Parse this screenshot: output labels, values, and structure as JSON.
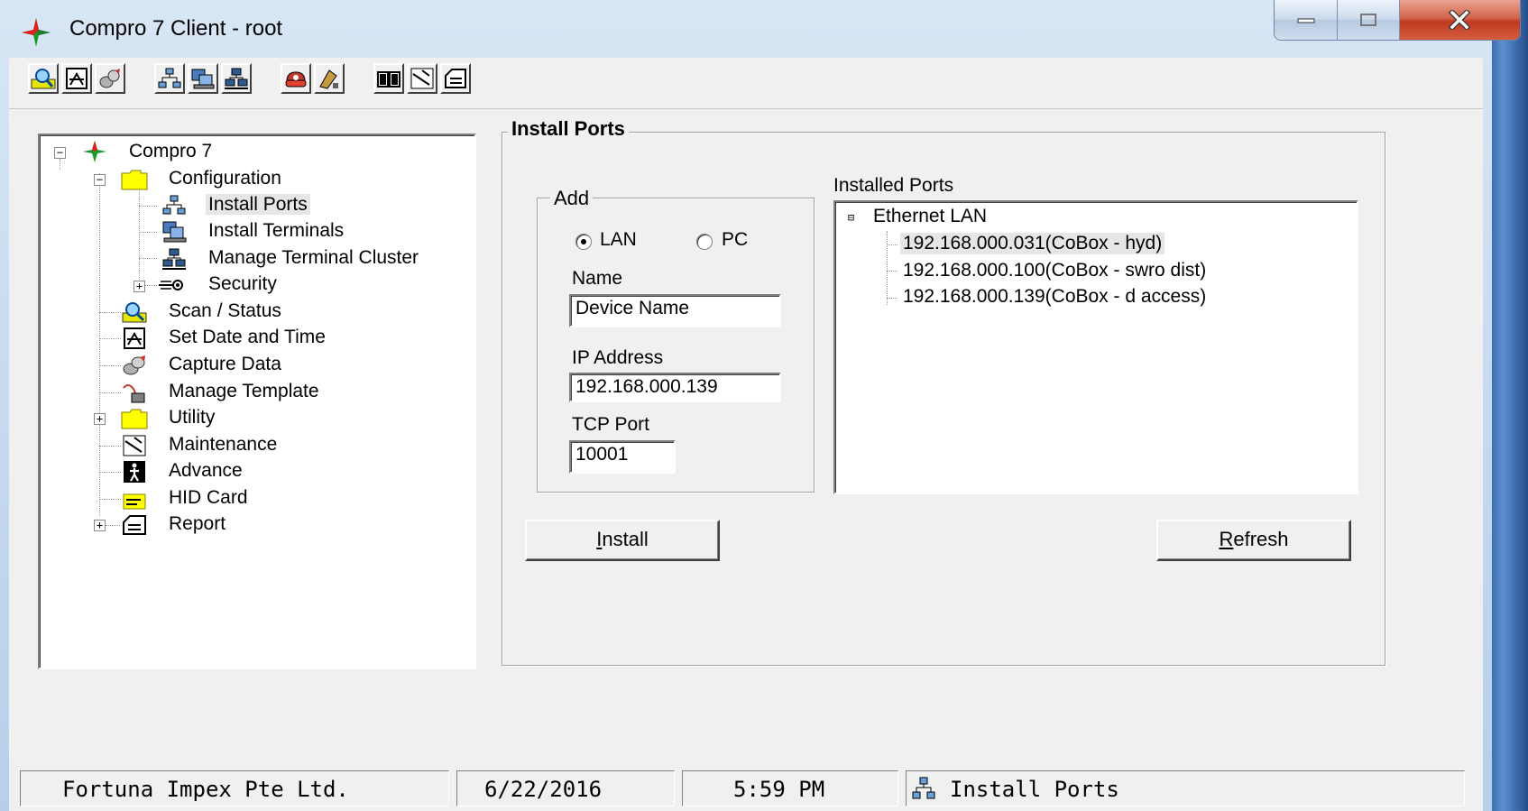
{
  "window": {
    "title": "Compro 7 Client - root",
    "controls": {
      "minimize": "minimize",
      "maximize": "maximize",
      "close": "close"
    }
  },
  "toolbar": {
    "buttons": [
      {
        "name": "scan-status",
        "icon": "magnifier-icon"
      },
      {
        "name": "set-date-time",
        "icon": "clock-icon"
      },
      {
        "name": "capture-data",
        "icon": "capture-icon"
      },
      {
        "name": "install-ports",
        "icon": "network-icon"
      },
      {
        "name": "install-terminals",
        "icon": "terminal-icon"
      },
      {
        "name": "manage-cluster",
        "icon": "cluster-icon"
      },
      {
        "name": "security",
        "icon": "security-icon"
      },
      {
        "name": "utility",
        "icon": "utility-icon"
      },
      {
        "name": "report-book",
        "icon": "book-icon"
      },
      {
        "name": "maintenance",
        "icon": "maintenance-icon"
      },
      {
        "name": "report",
        "icon": "report-icon"
      }
    ]
  },
  "tree": {
    "root": "Compro 7",
    "items": {
      "configuration": "Configuration",
      "install_ports": "Install Ports",
      "install_terminals": "Install Terminals",
      "manage_cluster": "Manage Terminal Cluster",
      "security": "Security",
      "scan_status": "Scan / Status",
      "set_date_time": "Set Date and Time",
      "capture_data": "Capture Data",
      "manage_template": "Manage Template",
      "utility": "Utility",
      "maintenance": "Maintenance",
      "advance": "Advance",
      "hid_card": "HID Card",
      "report": "Report"
    }
  },
  "panel": {
    "title": "Install Ports",
    "add_group": {
      "title": "Add",
      "radio_lan": "LAN",
      "radio_pc": "PC",
      "selected": "LAN",
      "name_label": "Name",
      "name_value": "Device Name",
      "ip_label": "IP Address",
      "ip_value": "192.168.000.139",
      "port_label": "TCP Port",
      "port_value": "10001"
    },
    "installed": {
      "title": "Installed Ports",
      "root": "Ethernet LAN",
      "ports": [
        "192.168.000.031(CoBox - hyd)",
        "192.168.000.100(CoBox - swro dist)",
        "192.168.000.139(CoBox - d access)"
      ]
    },
    "install_button": {
      "prefix": "",
      "underlined": "I",
      "rest": "nstall"
    },
    "refresh_button": {
      "prefix": "",
      "underlined": "R",
      "rest": "efresh"
    }
  },
  "status_bar": {
    "company": "Fortuna Impex Pte Ltd.",
    "date": "6/22/2016",
    "time": "5:59 PM",
    "current_view": "Install Ports"
  },
  "colors": {
    "title_gradient_top": "#d8e6f5",
    "close_button": "#c0391f",
    "folder_yellow": "#ffff00",
    "selection_bg": "#e6e6e6"
  }
}
